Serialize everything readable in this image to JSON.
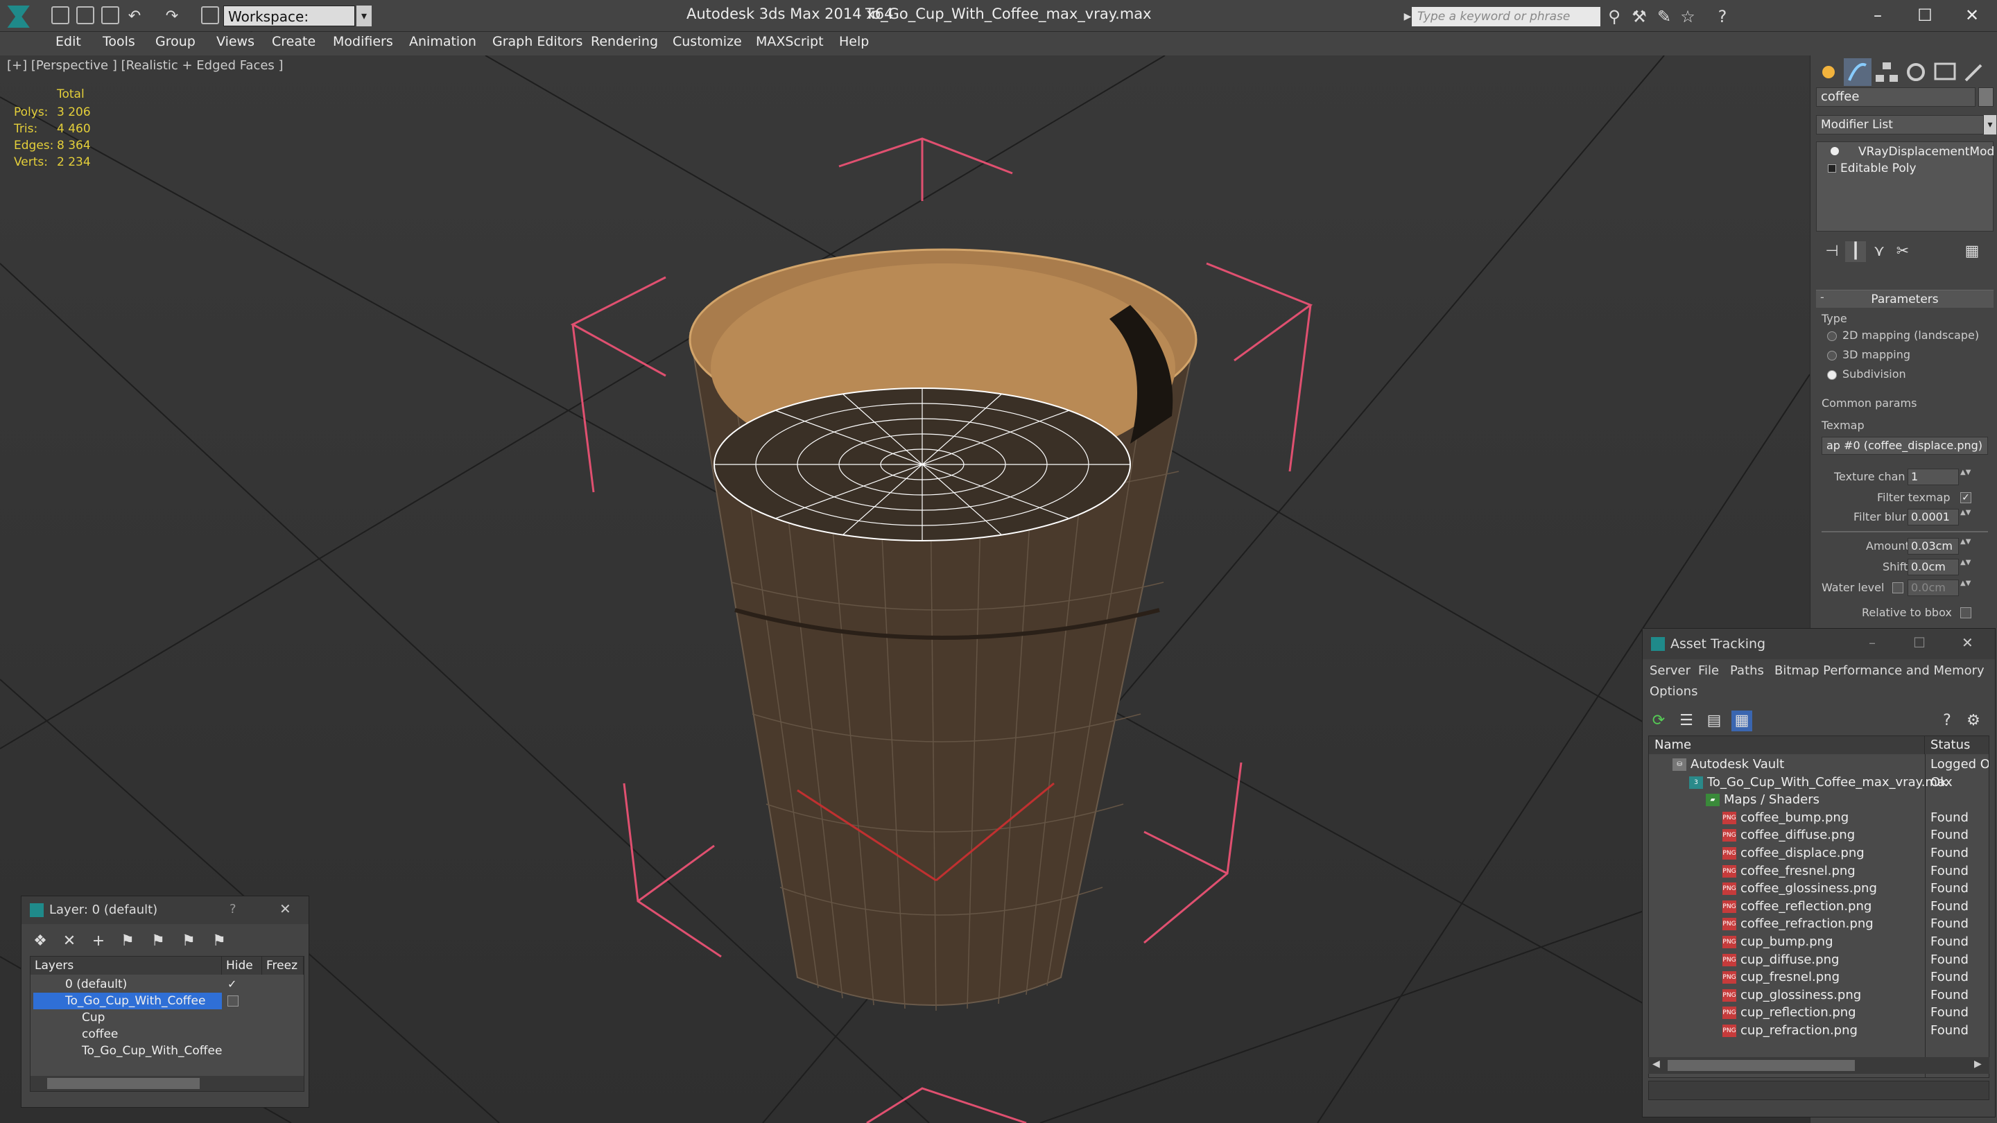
{
  "app": {
    "title": "Autodesk 3ds Max  2014 x64",
    "document": "To_Go_Cup_With_Coffee_max_vray.max",
    "workspace": "Workspace: Default",
    "search_placeholder": "Type a keyword or phrase"
  },
  "menu": [
    "Edit",
    "Tools",
    "Group",
    "Views",
    "Create",
    "Modifiers",
    "Animation",
    "Graph Editors",
    "Rendering",
    "Customize",
    "MAXScript",
    "Help"
  ],
  "viewport": {
    "label": "[+] [Perspective ] [Realistic + Edged Faces ]",
    "stats": {
      "header": "Total",
      "rows": [
        {
          "label": "Polys:",
          "value": "3 206"
        },
        {
          "label": "Tris:",
          "value": "4 460"
        },
        {
          "label": "Edges:",
          "value": "8 364"
        },
        {
          "label": "Verts:",
          "value": "2 234"
        }
      ]
    }
  },
  "command_panel": {
    "object_name": "coffee",
    "modifier_list": "Modifier List",
    "stack": [
      "VRayDisplacementMod",
      "Editable Poly"
    ],
    "rollout": "Parameters",
    "type_group": "Type",
    "type_options": [
      "2D mapping (landscape)",
      "3D mapping",
      "Subdivision"
    ],
    "type_selected": 2,
    "common_params": "Common params",
    "texmap_label": "Texmap",
    "texmap_value": "ap #0 (coffee_displace.png)",
    "texture_chan_label": "Texture chan",
    "texture_chan_value": "1",
    "filter_texmap_label": "Filter texmap",
    "filter_blur_label": "Filter blur",
    "filter_blur_value": "0.0001",
    "amount_label": "Amount",
    "amount_value": "0.03cm",
    "shift_label": "Shift",
    "shift_value": "0.0cm",
    "water_level_label": "Water level",
    "water_level_value": "0.0cm",
    "relative_bbox_label": "Relative to bbox"
  },
  "layer_window": {
    "title": "Layer: 0 (default)",
    "help": "?",
    "close": "✕",
    "columns": [
      "Layers",
      "Hide",
      "Freez"
    ],
    "rows": [
      {
        "name": "0 (default)",
        "indent": 1,
        "selected": false
      },
      {
        "name": "To_Go_Cup_With_Coffee",
        "indent": 1,
        "selected": true
      },
      {
        "name": "Cup",
        "indent": 2,
        "selected": false
      },
      {
        "name": "coffee",
        "indent": 2,
        "selected": false
      },
      {
        "name": "To_Go_Cup_With_Coffee",
        "indent": 2,
        "selected": false
      }
    ]
  },
  "asset_window": {
    "title": "Asset Tracking",
    "menu_row1": [
      "Server",
      "File",
      "Paths",
      "Bitmap Performance and Memory"
    ],
    "menu_row2": [
      "Options"
    ],
    "columns": [
      "Name",
      "Status"
    ],
    "rows": [
      {
        "name": "Autodesk Vault",
        "status": "Logged O",
        "indent": 1,
        "kind": "vault"
      },
      {
        "name": "To_Go_Cup_With_Coffee_max_vray.max",
        "status": "Ok",
        "indent": 2,
        "kind": "max"
      },
      {
        "name": "Maps / Shaders",
        "status": "",
        "indent": 3,
        "kind": "folder"
      },
      {
        "name": "coffee_bump.png",
        "status": "Found",
        "indent": 4,
        "kind": "png"
      },
      {
        "name": "coffee_diffuse.png",
        "status": "Found",
        "indent": 4,
        "kind": "png"
      },
      {
        "name": "coffee_displace.png",
        "status": "Found",
        "indent": 4,
        "kind": "png"
      },
      {
        "name": "coffee_fresnel.png",
        "status": "Found",
        "indent": 4,
        "kind": "png"
      },
      {
        "name": "coffee_glossiness.png",
        "status": "Found",
        "indent": 4,
        "kind": "png"
      },
      {
        "name": "coffee_reflection.png",
        "status": "Found",
        "indent": 4,
        "kind": "png"
      },
      {
        "name": "coffee_refraction.png",
        "status": "Found",
        "indent": 4,
        "kind": "png"
      },
      {
        "name": "cup_bump.png",
        "status": "Found",
        "indent": 4,
        "kind": "png"
      },
      {
        "name": "cup_diffuse.png",
        "status": "Found",
        "indent": 4,
        "kind": "png"
      },
      {
        "name": "cup_fresnel.png",
        "status": "Found",
        "indent": 4,
        "kind": "png"
      },
      {
        "name": "cup_glossiness.png",
        "status": "Found",
        "indent": 4,
        "kind": "png"
      },
      {
        "name": "cup_reflection.png",
        "status": "Found",
        "indent": 4,
        "kind": "png"
      },
      {
        "name": "cup_refraction.png",
        "status": "Found",
        "indent": 4,
        "kind": "png"
      }
    ]
  },
  "colors": {
    "stats_text": "#e4cf3a",
    "selection": "#2f6fd6",
    "gizmo": "#e05070",
    "cup_outer": "#4a3a2c",
    "cup_inner": "#b98a55"
  }
}
